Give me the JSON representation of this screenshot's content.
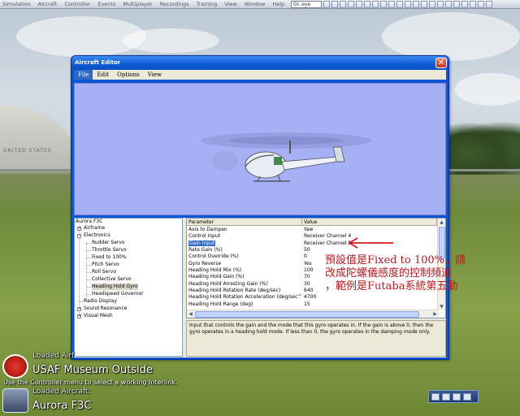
{
  "top_menu": [
    "Simulation",
    "Aircraft",
    "Controller",
    "Events",
    "Multiplayer",
    "Recordings",
    "Training",
    "View",
    "Window",
    "Help"
  ],
  "quick_select_value": "Gr..eye",
  "scene_building_text": "UNITED STATES",
  "window": {
    "title": "Aircraft Editor",
    "close_label": "✕",
    "menu": [
      "File",
      "Edit",
      "Options",
      "View"
    ]
  },
  "tree": {
    "root": "Aurora F3C",
    "airframe": "Airframe",
    "electronics": "Electronics",
    "rudder_servo": "Rudder Servo",
    "throttle_servo": "Throttle Servo",
    "fixed": "Fixed to 100%",
    "pitch_servo": "Pitch Servo",
    "roll_servo": "Roll Servo",
    "collective_servo": "Collective Servo",
    "heading_hold_gyro": "Heading Hold Gyro",
    "headspeed_governor": "Headspeed Governor",
    "radio_display": "Radio Display",
    "sound_resonance": "Sound Resonance",
    "visual_mesh": "Visual Mesh"
  },
  "grid": {
    "header": {
      "param": "Parameter",
      "value": "Value"
    },
    "rows": [
      {
        "param": "Axis to Dampen",
        "value": "Yaw"
      },
      {
        "param": "Control Input",
        "value": "Receiver Channel 4"
      },
      {
        "param": "Gain Input",
        "value": "Receiver Channel 5"
      },
      {
        "param": "Rate Gain (%)",
        "value": "50"
      },
      {
        "param": "Control Override (%)",
        "value": "0"
      },
      {
        "param": "Gyro Reverse",
        "value": "Yes"
      },
      {
        "param": "Heading Hold Mix (%)",
        "value": "100"
      },
      {
        "param": "Heading Hold Gain (%)",
        "value": "70"
      },
      {
        "param": "Heading Hold Arresting Gain (%)",
        "value": "30"
      },
      {
        "param": "Heading Hold Rotation Rate (deg/sec)",
        "value": "640"
      },
      {
        "param": "Heading Hold Rotation Acceleration (deg/sec^2)",
        "value": "4700"
      },
      {
        "param": "Heading Hold Range (deg)",
        "value": "15"
      }
    ]
  },
  "description": "Input that controls the gain and the mode that this gyro operates in. If the gain is above 0, then the gyro operates in a heading hold mode. If less than 0, the gyro operates in the damping mode only.",
  "annotation": {
    "line1": "預設值是Fixed to 100%，請",
    "line2": "改成陀螺儀感度的控制頻道",
    "line3": "，範例是Futaba系統第五動"
  },
  "overlay": {
    "loaded_airfield_label": "Loaded Airf",
    "airfield_name": "USAF Museum Outside",
    "hint": "Use the Controller menu to select a working Interlink.",
    "loaded_aircraft_label": "Loaded Aircraft:",
    "aircraft_name": "Aurora F3C"
  },
  "colors": {
    "selection": "#316ac5",
    "annotation": "#c0181c",
    "viewport": "#a6b0f4"
  }
}
